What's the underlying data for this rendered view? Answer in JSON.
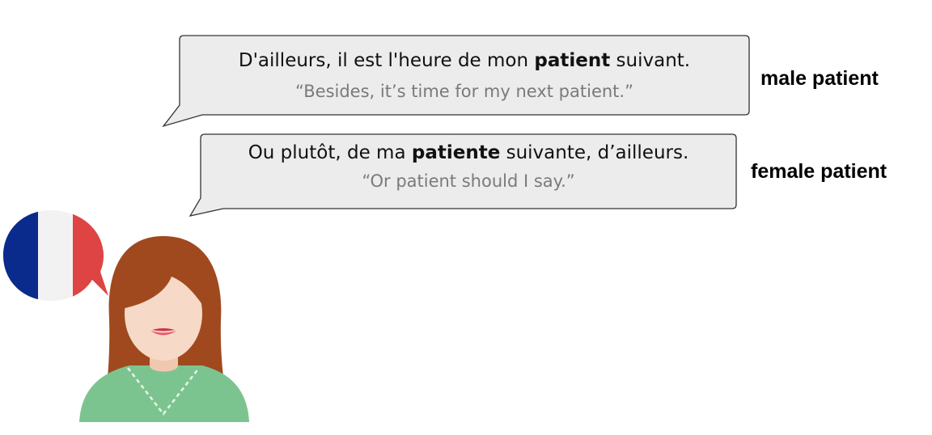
{
  "bubble_male": {
    "french_before": "D'ailleurs, il est l'heure de mon ",
    "french_bold": "patient",
    "french_after": " suivant.",
    "english": "“Besides, it’s time for my next patient.”",
    "label": "male patient"
  },
  "bubble_female": {
    "french_before": "Ou plutôt, de ma ",
    "french_bold": "patiente",
    "french_after": " suivante, d’ailleurs.",
    "english": "“Or patient should I say.”",
    "label": "female patient"
  },
  "colors": {
    "bubble_fill": "#ececec",
    "bubble_stroke": "#333333",
    "flag_blue": "#0a2a8c",
    "flag_white": "#f2f2f2",
    "flag_red": "#de4444",
    "hair": "#a0491f",
    "skin": "#f6d9c7",
    "shirt": "#7cc48f"
  },
  "icons": [
    "french-flag-speech-icon",
    "woman-speaker-icon"
  ]
}
